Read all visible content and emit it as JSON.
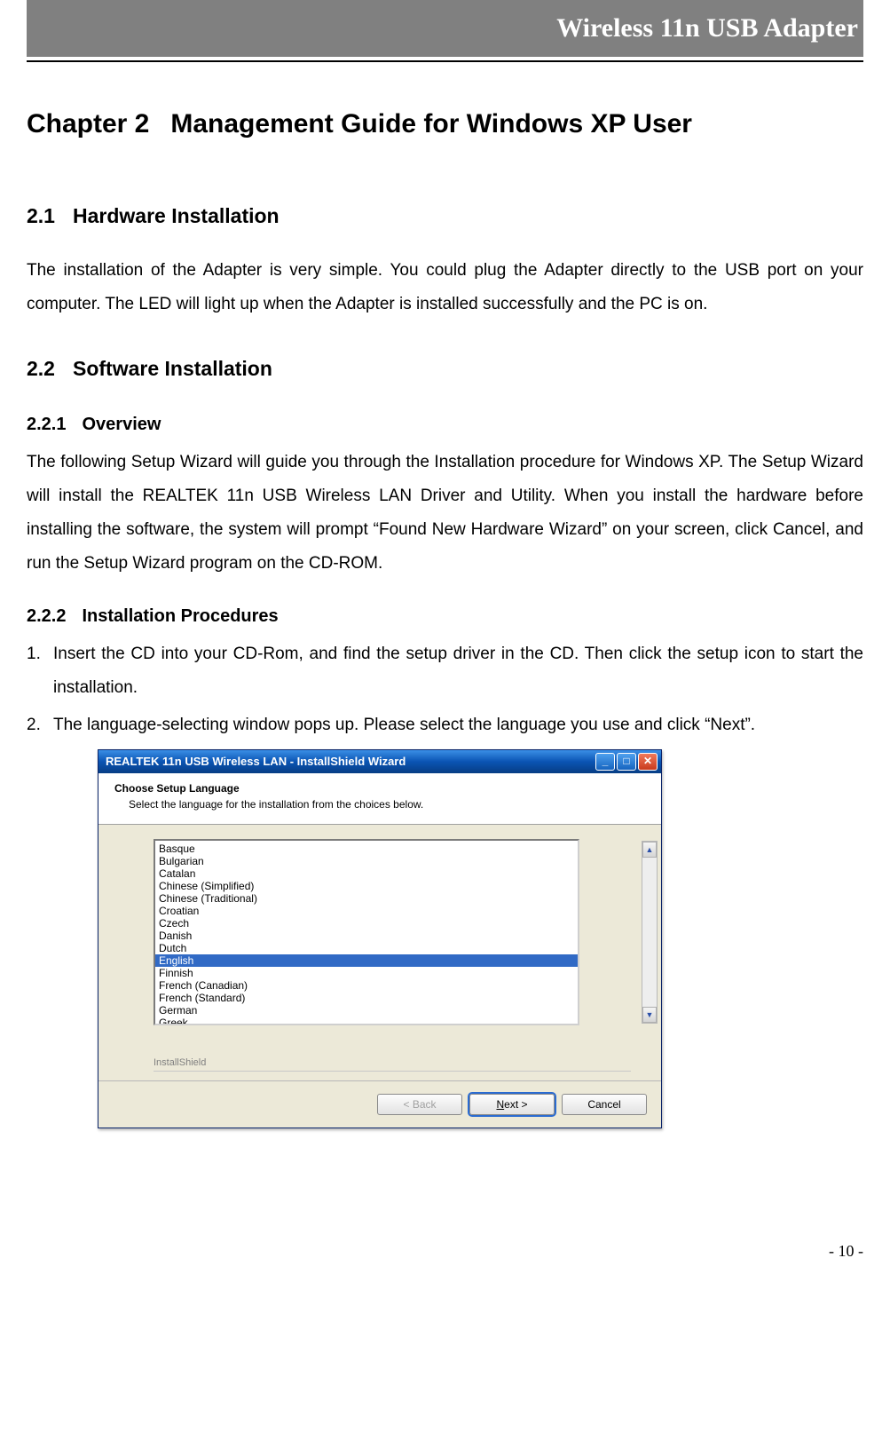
{
  "header": {
    "product": "Wireless 11n USB Adapter"
  },
  "chapter": {
    "number": "Chapter 2",
    "title": "Management Guide for Windows XP User"
  },
  "sections": {
    "s21": {
      "num": "2.1",
      "title": "Hardware Installation",
      "text": "The installation of the Adapter is very simple. You could plug the Adapter directly to the USB port on your computer. The LED will light up when the Adapter is installed successfully and the PC is on."
    },
    "s22": {
      "num": "2.2",
      "title": "Software Installation",
      "s221": {
        "num": "2.2.1",
        "title": "Overview",
        "text": "The following Setup Wizard will guide you through the Installation procedure for Windows XP. The Setup Wizard will install the REALTEK 11n USB Wireless LAN Driver and Utility. When you install the hardware before installing the software, the system will prompt “Found New Hardware Wizard” on your screen, click Cancel, and run the Setup Wizard program on the CD-ROM."
      },
      "s222": {
        "num": "2.2.2",
        "title": "Installation Procedures",
        "steps": [
          "Insert the CD into your CD-Rom, and find the setup driver in the CD. Then click the setup icon to start the installation.",
          "The language-selecting window pops up. Please select the language you use and click “Next”."
        ]
      }
    }
  },
  "wizard": {
    "titlebar": "REALTEK 11n USB Wireless LAN - InstallShield Wizard",
    "banner_title": "Choose Setup Language",
    "banner_sub": "Select the language for the installation from the choices below.",
    "brand": "InstallShield",
    "languages": [
      "Basque",
      "Bulgarian",
      "Catalan",
      "Chinese (Simplified)",
      "Chinese (Traditional)",
      "Croatian",
      "Czech",
      "Danish",
      "Dutch",
      "English",
      "Finnish",
      "French (Canadian)",
      "French (Standard)",
      "German",
      "Greek"
    ],
    "selected_index": 9,
    "buttons": {
      "back": "< Back",
      "next": "Next >",
      "cancel": "Cancel"
    },
    "win_buttons": {
      "minimize": "_",
      "maximize": "□",
      "close": "✕"
    }
  },
  "page_number": "- 10 -"
}
